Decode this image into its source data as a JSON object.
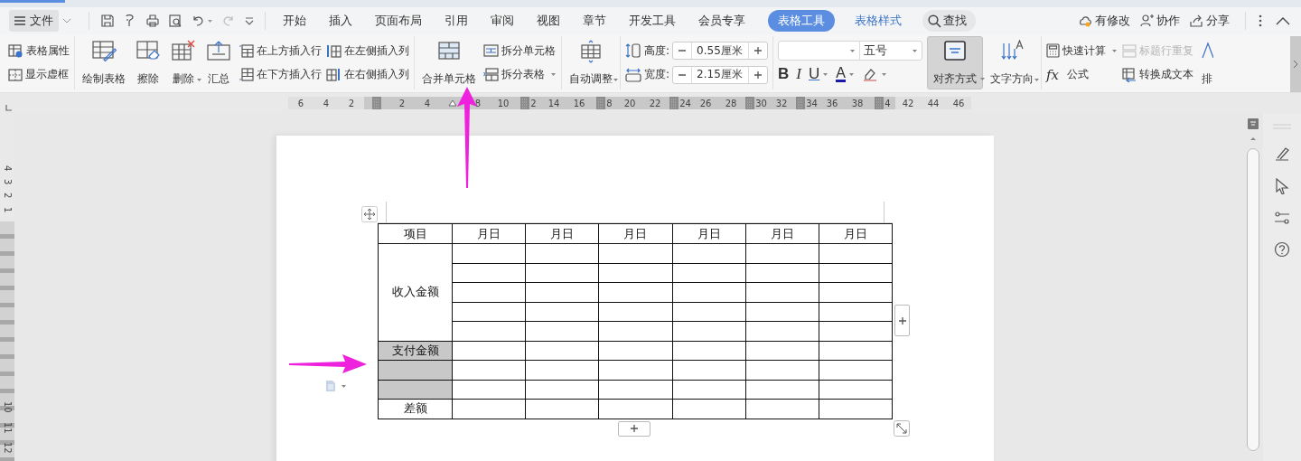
{
  "menu_bar": {
    "file_label": "文件",
    "tabs": [
      {
        "label": "开始",
        "selected": false,
        "kind": "main"
      },
      {
        "label": "插入",
        "selected": false,
        "kind": "main"
      },
      {
        "label": "页面布局",
        "selected": false,
        "kind": "main"
      },
      {
        "label": "引用",
        "selected": false,
        "kind": "main"
      },
      {
        "label": "审阅",
        "selected": false,
        "kind": "main"
      },
      {
        "label": "视图",
        "selected": false,
        "kind": "main"
      },
      {
        "label": "章节",
        "selected": false,
        "kind": "main"
      },
      {
        "label": "开发工具",
        "selected": false,
        "kind": "main"
      },
      {
        "label": "会员专享",
        "selected": false,
        "kind": "main"
      },
      {
        "label": "表格工具",
        "selected": true,
        "kind": "context"
      },
      {
        "label": "表格样式",
        "selected": false,
        "kind": "context"
      }
    ],
    "search_label": "查找",
    "actions": [
      "有修改",
      "协作",
      "分享"
    ]
  },
  "ribbon": {
    "groups": [
      {
        "items": [
          {
            "kind": "stack",
            "items": [
              {
                "label": "表格属性",
                "dropdown": false,
                "disabled": false
              },
              {
                "label": "显示虚框",
                "dropdown": false,
                "disabled": false
              }
            ]
          }
        ]
      },
      {
        "items": [
          {
            "kind": "big",
            "label": "绘制表格",
            "dropdown": false,
            "selected": false
          },
          {
            "kind": "big",
            "label": "擦除",
            "dropdown": false,
            "selected": false
          },
          {
            "kind": "big",
            "label": "删除",
            "dropdown": true,
            "selected": false
          },
          {
            "kind": "big",
            "label": "汇总",
            "dropdown": false,
            "selected": false
          },
          {
            "kind": "stack",
            "items": [
              {
                "label": "在上方插入行",
                "dropdown": false,
                "disabled": false
              },
              {
                "label": "在下方插入行",
                "dropdown": false,
                "disabled": false
              }
            ]
          },
          {
            "kind": "stack",
            "items": [
              {
                "label": "在左侧插入列",
                "dropdown": false,
                "disabled": false
              },
              {
                "label": "在右侧插入列",
                "dropdown": false,
                "disabled": false
              }
            ]
          }
        ]
      },
      {
        "items": [
          {
            "kind": "big",
            "label": "合并单元格",
            "dropdown": false,
            "selected": false
          },
          {
            "kind": "stack",
            "items": [
              {
                "label": "拆分单元格",
                "dropdown": false,
                "disabled": false
              },
              {
                "label": "拆分表格",
                "dropdown": true,
                "disabled": false
              }
            ]
          }
        ]
      },
      {
        "items": [
          {
            "kind": "big",
            "label": "自动调整",
            "dropdown": true,
            "selected": false
          }
        ]
      },
      {
        "items": [
          {
            "kind": "spinners",
            "items": [
              {
                "label": "高度:",
                "value": "0.55厘米"
              },
              {
                "label": "宽度:",
                "value": "2.15厘米"
              }
            ]
          }
        ]
      },
      {
        "items": [
          {
            "kind": "font",
            "size": "五号",
            "buttons": [
              {
                "kind": "bold",
                "text": "B",
                "dropdown": false
              },
              {
                "kind": "italic",
                "text": "I",
                "dropdown": false
              },
              {
                "kind": "underline",
                "text": "U",
                "dropdown": true
              },
              {
                "kind": "color",
                "text": "A",
                "dropdown": true
              },
              {
                "kind": "highlight",
                "dropdown": true
              }
            ]
          },
          {
            "kind": "big",
            "label": "对齐方式",
            "dropdown": true,
            "selected": true
          },
          {
            "kind": "big",
            "label": "文字方向",
            "dropdown": true,
            "selected": false
          }
        ]
      },
      {
        "items": [
          {
            "kind": "stack",
            "items": [
              {
                "label": "快速计算",
                "dropdown": true,
                "disabled": false
              },
              {
                "label": "公式",
                "glyph": "fx",
                "dropdown": false,
                "disabled": false
              }
            ]
          },
          {
            "kind": "stack",
            "items": [
              {
                "label": "标题行重复",
                "dropdown": false,
                "disabled": true
              },
              {
                "label": "转换成文本",
                "dropdown": false,
                "disabled": false
              }
            ]
          },
          {
            "kind": "big",
            "label": "排",
            "dropdown": false,
            "selected": false
          }
        ]
      }
    ]
  },
  "ruler": {
    "slots": [
      {
        "kind": "number",
        "text": "6"
      },
      {
        "kind": "number",
        "text": "4"
      },
      {
        "kind": "number",
        "text": "2"
      },
      {
        "kind": "marker"
      },
      {
        "kind": "number",
        "text": "2"
      },
      {
        "kind": "number",
        "text": "4"
      },
      {
        "kind": "indent"
      },
      {
        "kind": "number",
        "text": "8"
      },
      {
        "kind": "number",
        "text": "10"
      },
      {
        "kind": "marker",
        "text": "2"
      },
      {
        "kind": "number",
        "text": "14"
      },
      {
        "kind": "number",
        "text": "16"
      },
      {
        "kind": "marker",
        "text": "8"
      },
      {
        "kind": "number",
        "text": "20"
      },
      {
        "kind": "number",
        "text": "22"
      },
      {
        "kind": "marker",
        "text": "24"
      },
      {
        "kind": "number",
        "text": "26"
      },
      {
        "kind": "number",
        "text": "28"
      },
      {
        "kind": "marker",
        "text": "30"
      },
      {
        "kind": "number",
        "text": "32"
      },
      {
        "kind": "marker",
        "text": "34"
      },
      {
        "kind": "number",
        "text": "36"
      },
      {
        "kind": "number",
        "text": "38"
      },
      {
        "kind": "marker",
        "text": "4"
      },
      {
        "kind": "number",
        "text": "42"
      },
      {
        "kind": "number",
        "text": "44"
      },
      {
        "kind": "number",
        "text": "46"
      }
    ]
  },
  "vertical_ruler": {
    "top_labels": [
      "4",
      "3",
      "2",
      "1"
    ],
    "bottom_labels": [
      "10",
      "11",
      "12"
    ]
  },
  "table": {
    "columns": [
      "项目",
      "月日",
      "月日",
      "月日",
      "月日",
      "月日",
      "月日"
    ],
    "row_groups": [
      {
        "label": "收入金额",
        "selected": false,
        "rows": [
          {
            "kind": "blank"
          },
          {
            "kind": "blank"
          },
          {
            "kind": "blank"
          },
          {
            "kind": "blank"
          },
          {
            "kind": "blank"
          }
        ]
      },
      {
        "label": "支付金额",
        "selected": true,
        "rows": [
          {
            "kind": "blank"
          }
        ]
      },
      {
        "selected": true,
        "rows": [
          {
            "kind": "blank"
          }
        ]
      },
      {
        "selected": true,
        "rows": [
          {
            "kind": "blank"
          }
        ]
      },
      {
        "label": "差额",
        "selected": false,
        "rows": [
          {
            "kind": "blank"
          }
        ]
      }
    ]
  }
}
